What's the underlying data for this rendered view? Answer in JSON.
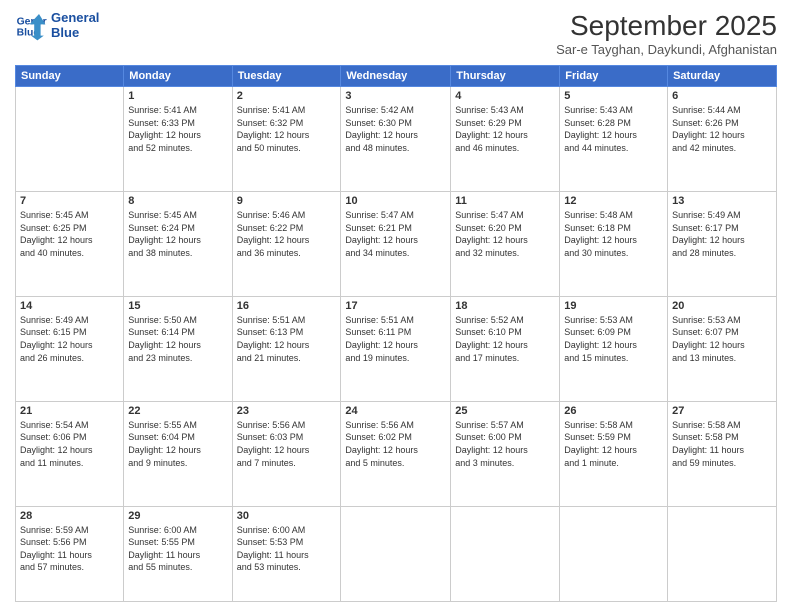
{
  "logo": {
    "line1": "General",
    "line2": "Blue"
  },
  "title": "September 2025",
  "subtitle": "Sar-e Tayghan, Daykundi, Afghanistan",
  "weekdays": [
    "Sunday",
    "Monday",
    "Tuesday",
    "Wednesday",
    "Thursday",
    "Friday",
    "Saturday"
  ],
  "weeks": [
    [
      {
        "day": "",
        "info": ""
      },
      {
        "day": "1",
        "info": "Sunrise: 5:41 AM\nSunset: 6:33 PM\nDaylight: 12 hours\nand 52 minutes."
      },
      {
        "day": "2",
        "info": "Sunrise: 5:41 AM\nSunset: 6:32 PM\nDaylight: 12 hours\nand 50 minutes."
      },
      {
        "day": "3",
        "info": "Sunrise: 5:42 AM\nSunset: 6:30 PM\nDaylight: 12 hours\nand 48 minutes."
      },
      {
        "day": "4",
        "info": "Sunrise: 5:43 AM\nSunset: 6:29 PM\nDaylight: 12 hours\nand 46 minutes."
      },
      {
        "day": "5",
        "info": "Sunrise: 5:43 AM\nSunset: 6:28 PM\nDaylight: 12 hours\nand 44 minutes."
      },
      {
        "day": "6",
        "info": "Sunrise: 5:44 AM\nSunset: 6:26 PM\nDaylight: 12 hours\nand 42 minutes."
      }
    ],
    [
      {
        "day": "7",
        "info": "Sunrise: 5:45 AM\nSunset: 6:25 PM\nDaylight: 12 hours\nand 40 minutes."
      },
      {
        "day": "8",
        "info": "Sunrise: 5:45 AM\nSunset: 6:24 PM\nDaylight: 12 hours\nand 38 minutes."
      },
      {
        "day": "9",
        "info": "Sunrise: 5:46 AM\nSunset: 6:22 PM\nDaylight: 12 hours\nand 36 minutes."
      },
      {
        "day": "10",
        "info": "Sunrise: 5:47 AM\nSunset: 6:21 PM\nDaylight: 12 hours\nand 34 minutes."
      },
      {
        "day": "11",
        "info": "Sunrise: 5:47 AM\nSunset: 6:20 PM\nDaylight: 12 hours\nand 32 minutes."
      },
      {
        "day": "12",
        "info": "Sunrise: 5:48 AM\nSunset: 6:18 PM\nDaylight: 12 hours\nand 30 minutes."
      },
      {
        "day": "13",
        "info": "Sunrise: 5:49 AM\nSunset: 6:17 PM\nDaylight: 12 hours\nand 28 minutes."
      }
    ],
    [
      {
        "day": "14",
        "info": "Sunrise: 5:49 AM\nSunset: 6:15 PM\nDaylight: 12 hours\nand 26 minutes."
      },
      {
        "day": "15",
        "info": "Sunrise: 5:50 AM\nSunset: 6:14 PM\nDaylight: 12 hours\nand 23 minutes."
      },
      {
        "day": "16",
        "info": "Sunrise: 5:51 AM\nSunset: 6:13 PM\nDaylight: 12 hours\nand 21 minutes."
      },
      {
        "day": "17",
        "info": "Sunrise: 5:51 AM\nSunset: 6:11 PM\nDaylight: 12 hours\nand 19 minutes."
      },
      {
        "day": "18",
        "info": "Sunrise: 5:52 AM\nSunset: 6:10 PM\nDaylight: 12 hours\nand 17 minutes."
      },
      {
        "day": "19",
        "info": "Sunrise: 5:53 AM\nSunset: 6:09 PM\nDaylight: 12 hours\nand 15 minutes."
      },
      {
        "day": "20",
        "info": "Sunrise: 5:53 AM\nSunset: 6:07 PM\nDaylight: 12 hours\nand 13 minutes."
      }
    ],
    [
      {
        "day": "21",
        "info": "Sunrise: 5:54 AM\nSunset: 6:06 PM\nDaylight: 12 hours\nand 11 minutes."
      },
      {
        "day": "22",
        "info": "Sunrise: 5:55 AM\nSunset: 6:04 PM\nDaylight: 12 hours\nand 9 minutes."
      },
      {
        "day": "23",
        "info": "Sunrise: 5:56 AM\nSunset: 6:03 PM\nDaylight: 12 hours\nand 7 minutes."
      },
      {
        "day": "24",
        "info": "Sunrise: 5:56 AM\nSunset: 6:02 PM\nDaylight: 12 hours\nand 5 minutes."
      },
      {
        "day": "25",
        "info": "Sunrise: 5:57 AM\nSunset: 6:00 PM\nDaylight: 12 hours\nand 3 minutes."
      },
      {
        "day": "26",
        "info": "Sunrise: 5:58 AM\nSunset: 5:59 PM\nDaylight: 12 hours\nand 1 minute."
      },
      {
        "day": "27",
        "info": "Sunrise: 5:58 AM\nSunset: 5:58 PM\nDaylight: 11 hours\nand 59 minutes."
      }
    ],
    [
      {
        "day": "28",
        "info": "Sunrise: 5:59 AM\nSunset: 5:56 PM\nDaylight: 11 hours\nand 57 minutes."
      },
      {
        "day": "29",
        "info": "Sunrise: 6:00 AM\nSunset: 5:55 PM\nDaylight: 11 hours\nand 55 minutes."
      },
      {
        "day": "30",
        "info": "Sunrise: 6:00 AM\nSunset: 5:53 PM\nDaylight: 11 hours\nand 53 minutes."
      },
      {
        "day": "",
        "info": ""
      },
      {
        "day": "",
        "info": ""
      },
      {
        "day": "",
        "info": ""
      },
      {
        "day": "",
        "info": ""
      }
    ]
  ]
}
